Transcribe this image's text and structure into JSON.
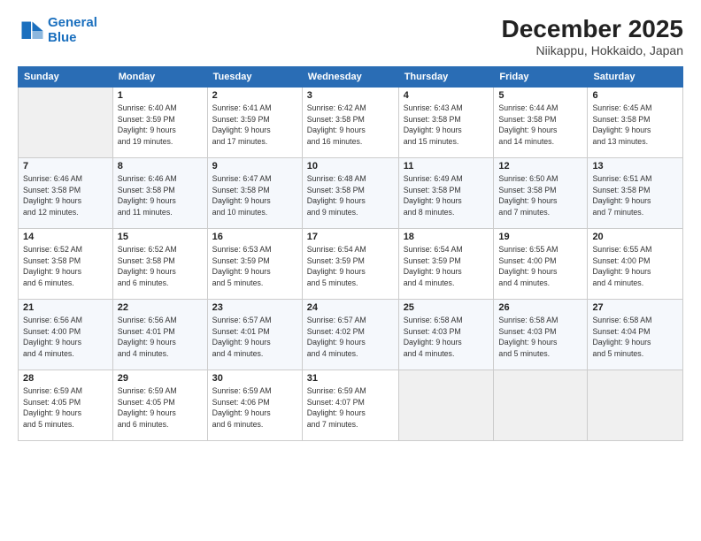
{
  "logo": {
    "line1": "General",
    "line2": "Blue"
  },
  "title": "December 2025",
  "subtitle": "Niikappu, Hokkaido, Japan",
  "weekdays": [
    "Sunday",
    "Monday",
    "Tuesday",
    "Wednesday",
    "Thursday",
    "Friday",
    "Saturday"
  ],
  "weeks": [
    [
      {
        "num": "",
        "info": ""
      },
      {
        "num": "1",
        "info": "Sunrise: 6:40 AM\nSunset: 3:59 PM\nDaylight: 9 hours\nand 19 minutes."
      },
      {
        "num": "2",
        "info": "Sunrise: 6:41 AM\nSunset: 3:59 PM\nDaylight: 9 hours\nand 17 minutes."
      },
      {
        "num": "3",
        "info": "Sunrise: 6:42 AM\nSunset: 3:58 PM\nDaylight: 9 hours\nand 16 minutes."
      },
      {
        "num": "4",
        "info": "Sunrise: 6:43 AM\nSunset: 3:58 PM\nDaylight: 9 hours\nand 15 minutes."
      },
      {
        "num": "5",
        "info": "Sunrise: 6:44 AM\nSunset: 3:58 PM\nDaylight: 9 hours\nand 14 minutes."
      },
      {
        "num": "6",
        "info": "Sunrise: 6:45 AM\nSunset: 3:58 PM\nDaylight: 9 hours\nand 13 minutes."
      }
    ],
    [
      {
        "num": "7",
        "info": "Sunrise: 6:46 AM\nSunset: 3:58 PM\nDaylight: 9 hours\nand 12 minutes."
      },
      {
        "num": "8",
        "info": "Sunrise: 6:46 AM\nSunset: 3:58 PM\nDaylight: 9 hours\nand 11 minutes."
      },
      {
        "num": "9",
        "info": "Sunrise: 6:47 AM\nSunset: 3:58 PM\nDaylight: 9 hours\nand 10 minutes."
      },
      {
        "num": "10",
        "info": "Sunrise: 6:48 AM\nSunset: 3:58 PM\nDaylight: 9 hours\nand 9 minutes."
      },
      {
        "num": "11",
        "info": "Sunrise: 6:49 AM\nSunset: 3:58 PM\nDaylight: 9 hours\nand 8 minutes."
      },
      {
        "num": "12",
        "info": "Sunrise: 6:50 AM\nSunset: 3:58 PM\nDaylight: 9 hours\nand 7 minutes."
      },
      {
        "num": "13",
        "info": "Sunrise: 6:51 AM\nSunset: 3:58 PM\nDaylight: 9 hours\nand 7 minutes."
      }
    ],
    [
      {
        "num": "14",
        "info": "Sunrise: 6:52 AM\nSunset: 3:58 PM\nDaylight: 9 hours\nand 6 minutes."
      },
      {
        "num": "15",
        "info": "Sunrise: 6:52 AM\nSunset: 3:58 PM\nDaylight: 9 hours\nand 6 minutes."
      },
      {
        "num": "16",
        "info": "Sunrise: 6:53 AM\nSunset: 3:59 PM\nDaylight: 9 hours\nand 5 minutes."
      },
      {
        "num": "17",
        "info": "Sunrise: 6:54 AM\nSunset: 3:59 PM\nDaylight: 9 hours\nand 5 minutes."
      },
      {
        "num": "18",
        "info": "Sunrise: 6:54 AM\nSunset: 3:59 PM\nDaylight: 9 hours\nand 4 minutes."
      },
      {
        "num": "19",
        "info": "Sunrise: 6:55 AM\nSunset: 4:00 PM\nDaylight: 9 hours\nand 4 minutes."
      },
      {
        "num": "20",
        "info": "Sunrise: 6:55 AM\nSunset: 4:00 PM\nDaylight: 9 hours\nand 4 minutes."
      }
    ],
    [
      {
        "num": "21",
        "info": "Sunrise: 6:56 AM\nSunset: 4:00 PM\nDaylight: 9 hours\nand 4 minutes."
      },
      {
        "num": "22",
        "info": "Sunrise: 6:56 AM\nSunset: 4:01 PM\nDaylight: 9 hours\nand 4 minutes."
      },
      {
        "num": "23",
        "info": "Sunrise: 6:57 AM\nSunset: 4:01 PM\nDaylight: 9 hours\nand 4 minutes."
      },
      {
        "num": "24",
        "info": "Sunrise: 6:57 AM\nSunset: 4:02 PM\nDaylight: 9 hours\nand 4 minutes."
      },
      {
        "num": "25",
        "info": "Sunrise: 6:58 AM\nSunset: 4:03 PM\nDaylight: 9 hours\nand 4 minutes."
      },
      {
        "num": "26",
        "info": "Sunrise: 6:58 AM\nSunset: 4:03 PM\nDaylight: 9 hours\nand 5 minutes."
      },
      {
        "num": "27",
        "info": "Sunrise: 6:58 AM\nSunset: 4:04 PM\nDaylight: 9 hours\nand 5 minutes."
      }
    ],
    [
      {
        "num": "28",
        "info": "Sunrise: 6:59 AM\nSunset: 4:05 PM\nDaylight: 9 hours\nand 5 minutes."
      },
      {
        "num": "29",
        "info": "Sunrise: 6:59 AM\nSunset: 4:05 PM\nDaylight: 9 hours\nand 6 minutes."
      },
      {
        "num": "30",
        "info": "Sunrise: 6:59 AM\nSunset: 4:06 PM\nDaylight: 9 hours\nand 6 minutes."
      },
      {
        "num": "31",
        "info": "Sunrise: 6:59 AM\nSunset: 4:07 PM\nDaylight: 9 hours\nand 7 minutes."
      },
      {
        "num": "",
        "info": ""
      },
      {
        "num": "",
        "info": ""
      },
      {
        "num": "",
        "info": ""
      }
    ]
  ]
}
